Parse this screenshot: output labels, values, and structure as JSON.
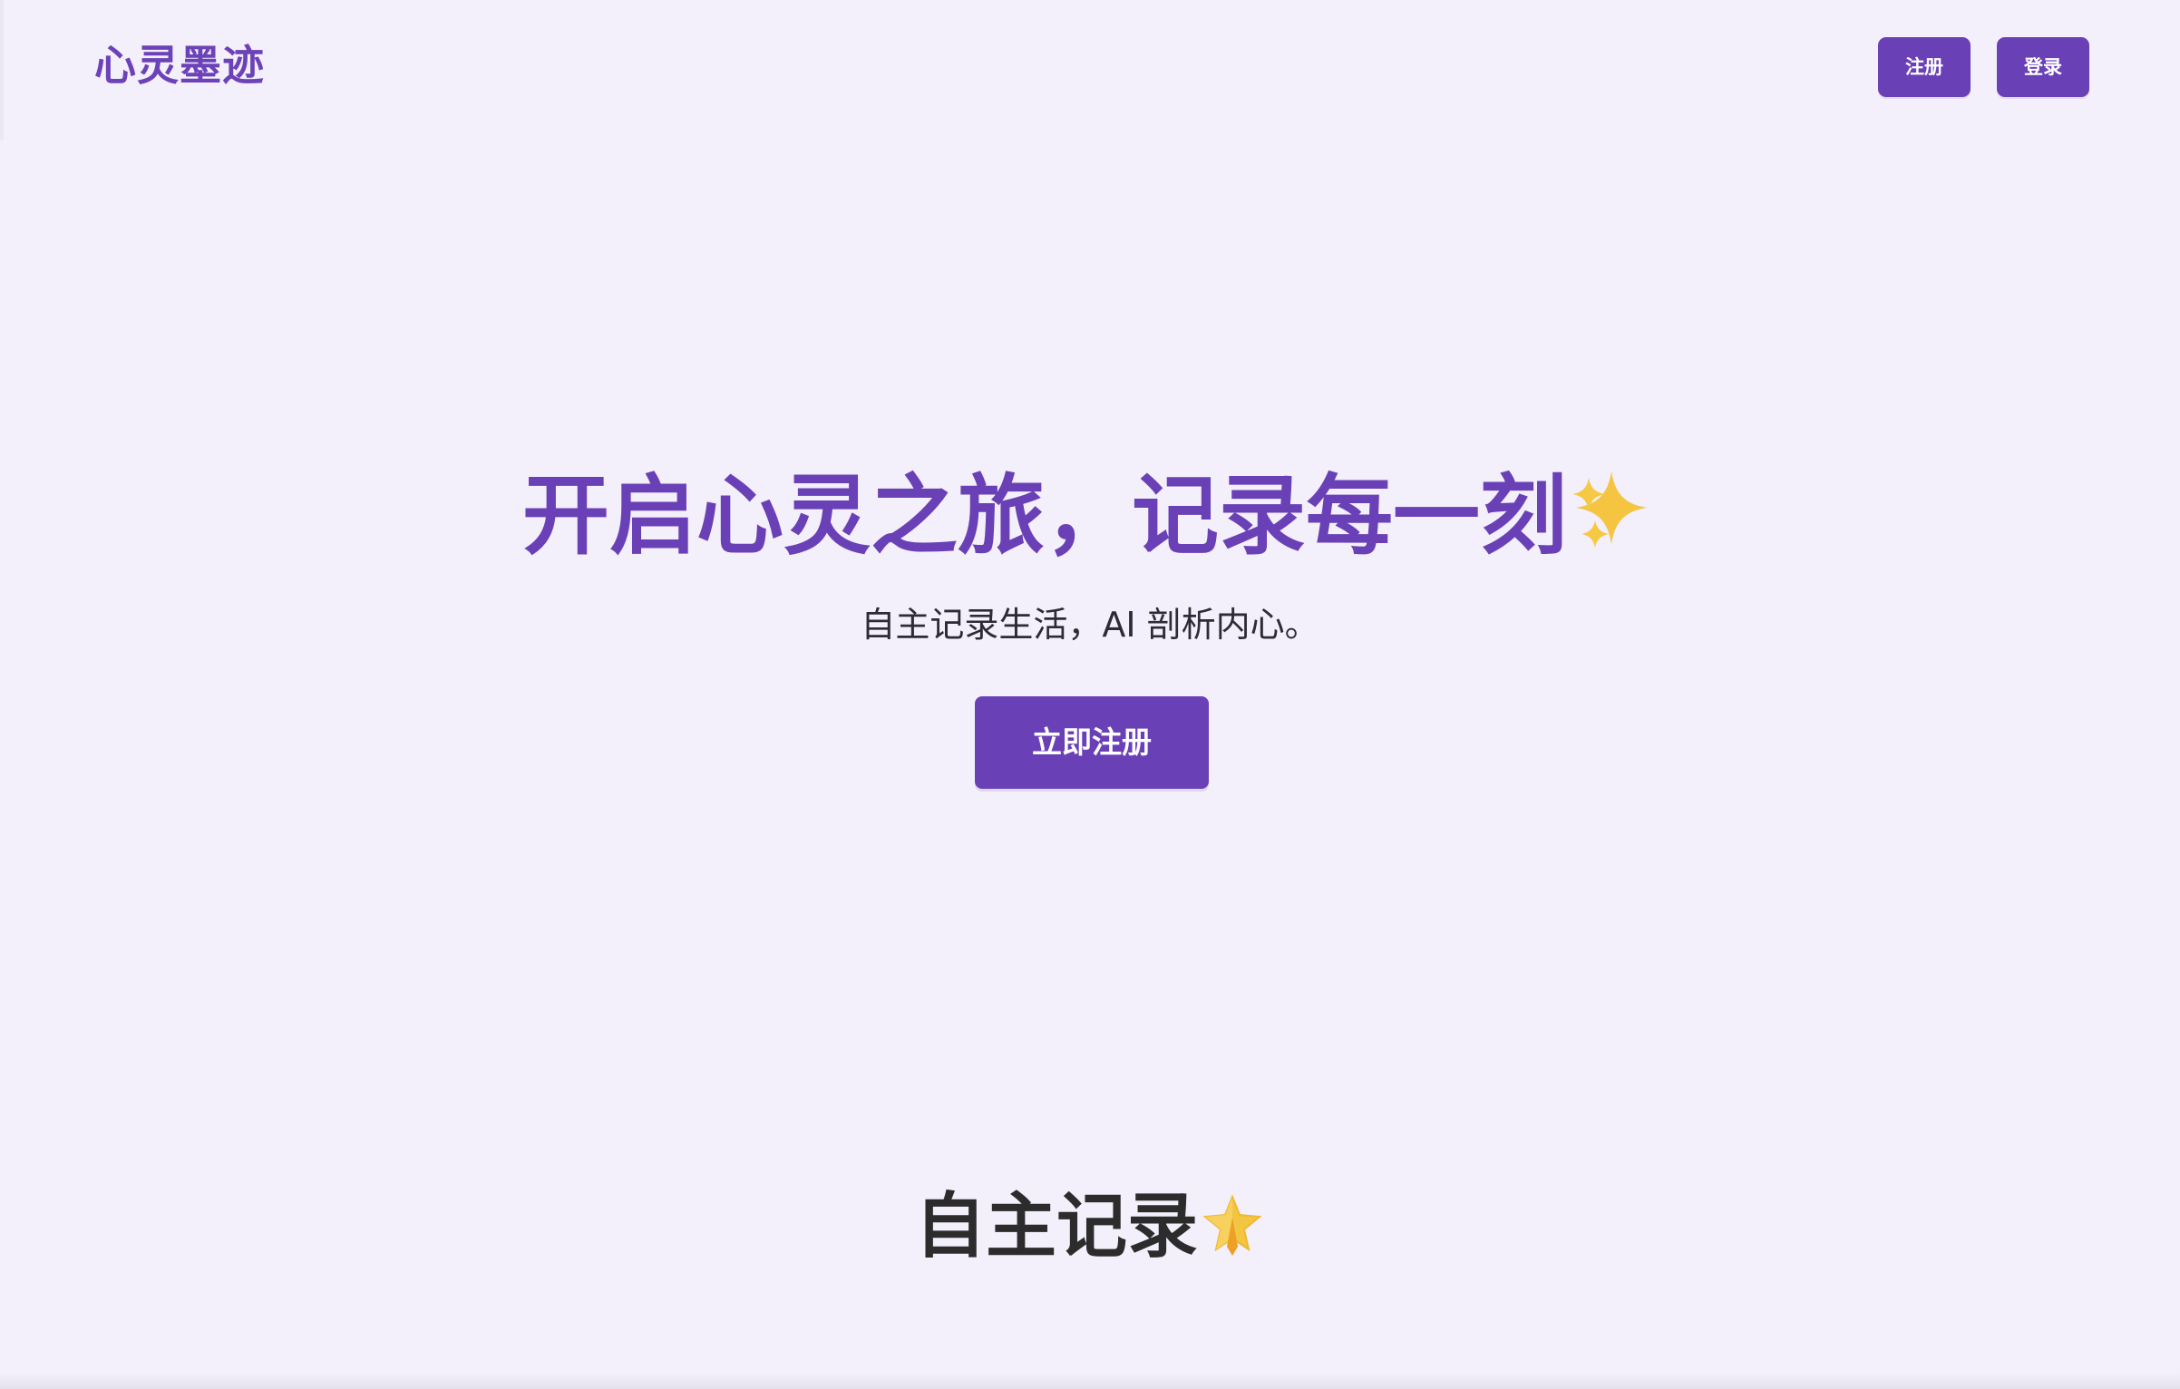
{
  "header": {
    "logo": "心灵墨迹",
    "register_label": "注册",
    "login_label": "登录"
  },
  "hero": {
    "title": "开启心灵之旅，记录每一刻",
    "title_icon": "sparkles-icon",
    "subtitle": "自主记录生活，AI 剖析内心。",
    "cta_label": "立即注册"
  },
  "section": {
    "title": "自主记录",
    "title_icon": "star-icon"
  },
  "colors": {
    "background": "#f3effb",
    "accent": "#6a40b7",
    "text_dark": "#2c2c2c",
    "button_text": "#ffffff",
    "sparkle": "#f5c542"
  }
}
